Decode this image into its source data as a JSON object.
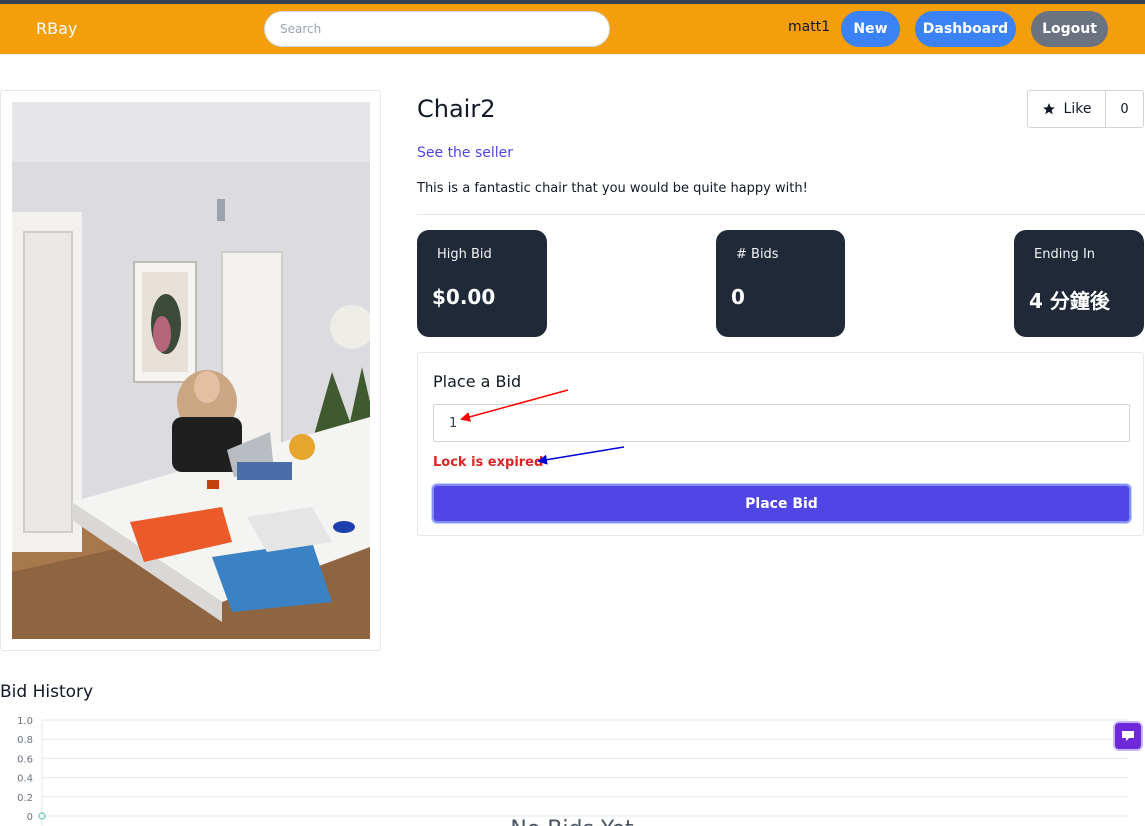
{
  "nav": {
    "brand": "RBay",
    "search_placeholder": "Search",
    "username": "matt1",
    "new_label": "New",
    "dashboard_label": "Dashboard",
    "logout_label": "Logout"
  },
  "item": {
    "title": "Chair2",
    "like_label": "Like",
    "like_count": "0",
    "seller_link": "See the seller",
    "description": "This is a fantastic chair that you would be quite happy with!"
  },
  "stats": [
    {
      "label": "High Bid",
      "value": "$0.00"
    },
    {
      "label": "# Bids",
      "value": "0"
    },
    {
      "label": "Ending In",
      "value": "4 分鐘後"
    }
  ],
  "bid": {
    "heading": "Place a Bid",
    "input_value": "1",
    "error": "Lock is expired",
    "button_label": "Place Bid"
  },
  "history": {
    "title": "Bid History",
    "empty_message": "No Bids Yet"
  },
  "colors": {
    "navbar": "#f59e0b",
    "primary": "#4f46e5",
    "nav_button": "#3b82f6",
    "logout_button": "#6b7280",
    "stat_card": "#1f2937",
    "error": "#dc2626",
    "annotation_red": "#ff0000",
    "annotation_blue": "#0000dd"
  },
  "icons": {
    "like": "star-icon",
    "help_widget": "chat-bubble-icon"
  },
  "chart_data": {
    "type": "line",
    "title": "Bid History",
    "y_ticks": [
      "1.0",
      "0.8",
      "0.6",
      "0.4",
      "0.2",
      "0"
    ],
    "ylim": [
      0,
      1
    ],
    "series": [],
    "grid": true,
    "annotation": "No Bids Yet"
  }
}
